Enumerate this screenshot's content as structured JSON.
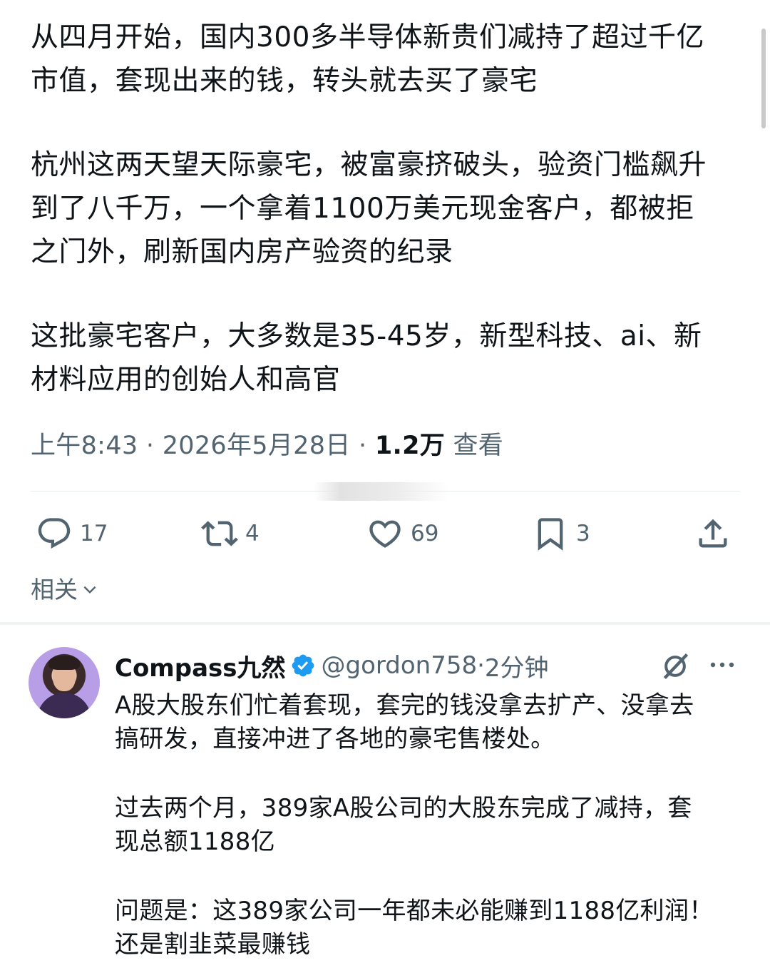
{
  "post": {
    "paragraphs": [
      "从四月开始，国内300多半导体新贵们减持了超过千亿\n市值，套现出来的钱，转头就去买了豪宅",
      "杭州这两天望天际豪宅，被富豪挤破头，验资门槛飙升\n到了八千万，一个拿着1100万美元现金客户，都被拒\n之门外，刷新国内房产验资的纪录",
      "这批豪宅客户，大多数是35-45岁，新型科技、ai、新\n材料应用的创始人和高官"
    ],
    "time": "上午8:43",
    "separator": " · ",
    "date": "2026年5月28日",
    "views": "1.2万",
    "views_label": "查看"
  },
  "actions": {
    "reply_count": "17",
    "retweet_count": "4",
    "like_count": "69",
    "bookmark_count": "3",
    "icons": [
      "reply-icon",
      "retweet-icon",
      "like-icon",
      "bookmark-icon",
      "share-icon"
    ]
  },
  "related": {
    "label": "相关"
  },
  "reply": {
    "name": "Compass九然",
    "handle": "@gordon758",
    "separator": " · ",
    "time": "2分钟",
    "paragraphs": [
      "A股大股东们忙着套现，套完的钱没拿去扩产、没拿去\n搞研发，直接冲进了各地的豪宅售楼处。",
      "过去两个月，389家A股公司的大股东完成了减持，套\n现总额1188亿",
      "问题是：这389家公司一年都未必能赚到1188亿利润！\n还是割韭菜最赚钱"
    ]
  },
  "colors": {
    "text": "#0f1419",
    "secondary": "#536471",
    "verified": "#1d9bf0",
    "divider": "#eff3f4"
  }
}
